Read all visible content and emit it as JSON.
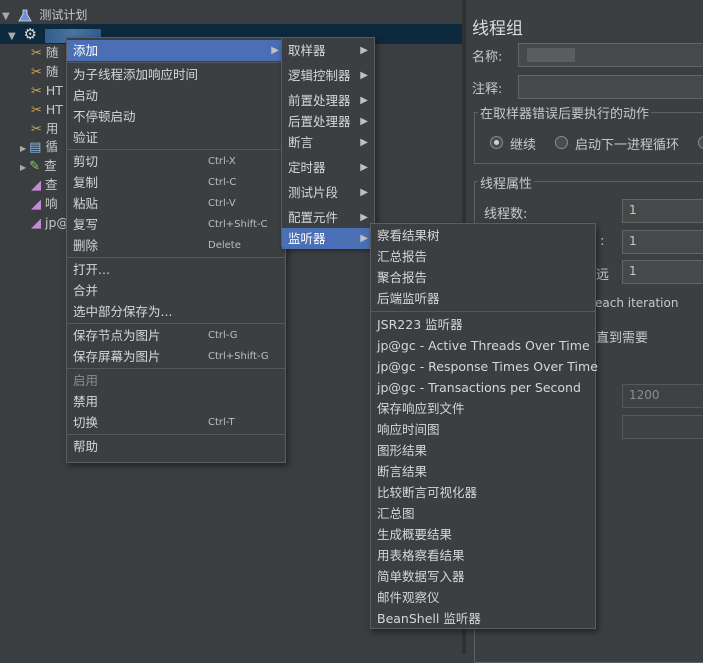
{
  "tree": {
    "root_label": "测试计划",
    "thread_group_label": "",
    "rows": [
      "随",
      "随",
      "HT",
      "HT",
      "用",
      "循",
      "查",
      "查",
      "响",
      "jp@"
    ]
  },
  "panel": {
    "title": "线程组",
    "name_label": "名称:",
    "comment_label": "注释:",
    "error_action_title": "在取样器错误后要执行的动作",
    "radio_continue": "继续",
    "radio_next_loop": "启动下一进程循环",
    "thread_props_title": "线程属性",
    "threads_label": "线程数:",
    "threads_value": "1",
    "rampup_label_frag": ":",
    "rampup_value": "1",
    "loop_label_frag": "远",
    "loop_value": "1",
    "same_user_frag": "each iteration",
    "delay_frag": "直到需要",
    "duration_value": "1200"
  },
  "context_menu": [
    {
      "label": "添加",
      "shortcut": "",
      "submenu": true,
      "highlight": true
    },
    {
      "separator": true
    },
    {
      "label": "为子线程添加响应时间",
      "shortcut": ""
    },
    {
      "label": "启动",
      "shortcut": ""
    },
    {
      "label": "不停顿启动",
      "shortcut": ""
    },
    {
      "label": "验证",
      "shortcut": ""
    },
    {
      "separator": true
    },
    {
      "label": "剪切",
      "shortcut": "Ctrl-X"
    },
    {
      "label": "复制",
      "shortcut": "Ctrl-C"
    },
    {
      "label": "粘贴",
      "shortcut": "Ctrl-V"
    },
    {
      "label": "复写",
      "shortcut": "Ctrl+Shift-C"
    },
    {
      "label": "删除",
      "shortcut": "Delete"
    },
    {
      "separator": true
    },
    {
      "label": "打开...",
      "shortcut": ""
    },
    {
      "label": "合并",
      "shortcut": ""
    },
    {
      "label": "选中部分保存为...",
      "shortcut": ""
    },
    {
      "separator": true
    },
    {
      "label": "保存节点为图片",
      "shortcut": "Ctrl-G"
    },
    {
      "label": "保存屏幕为图片",
      "shortcut": "Ctrl+Shift-G"
    },
    {
      "separator": true
    },
    {
      "label": "启用",
      "shortcut": "",
      "disabled": true
    },
    {
      "label": "禁用",
      "shortcut": ""
    },
    {
      "label": "切换",
      "shortcut": "Ctrl-T"
    },
    {
      "separator": true
    },
    {
      "label": "帮助",
      "shortcut": ""
    }
  ],
  "add_submenu": [
    {
      "label": "取样器",
      "gap": 0
    },
    {
      "label": "逻辑控制器",
      "gap": 1
    },
    {
      "label": "前置处理器",
      "gap": 1
    },
    {
      "label": "后置处理器",
      "gap": 0
    },
    {
      "label": "断言",
      "gap": 0
    },
    {
      "label": "定时器",
      "gap": 1
    },
    {
      "label": "测试片段",
      "gap": 1
    },
    {
      "label": "配置元件",
      "gap": 1
    },
    {
      "label": "监听器",
      "gap": 0,
      "highlight": true
    }
  ],
  "listener_submenu": [
    "察看结果树",
    "汇总报告",
    "聚合报告",
    "后端监听器",
    "JSR223 监听器",
    "jp@gc - Active Threads Over Time",
    "jp@gc - Response Times Over Time",
    "jp@gc - Transactions per Second",
    "保存响应到文件",
    "响应时间图",
    "图形结果",
    "断言结果",
    "比较断言可视化器",
    "汇总图",
    "生成概要结果",
    "用表格察看结果",
    "简单数据写入器",
    "邮件观察仪",
    "BeanShell 监听器"
  ]
}
